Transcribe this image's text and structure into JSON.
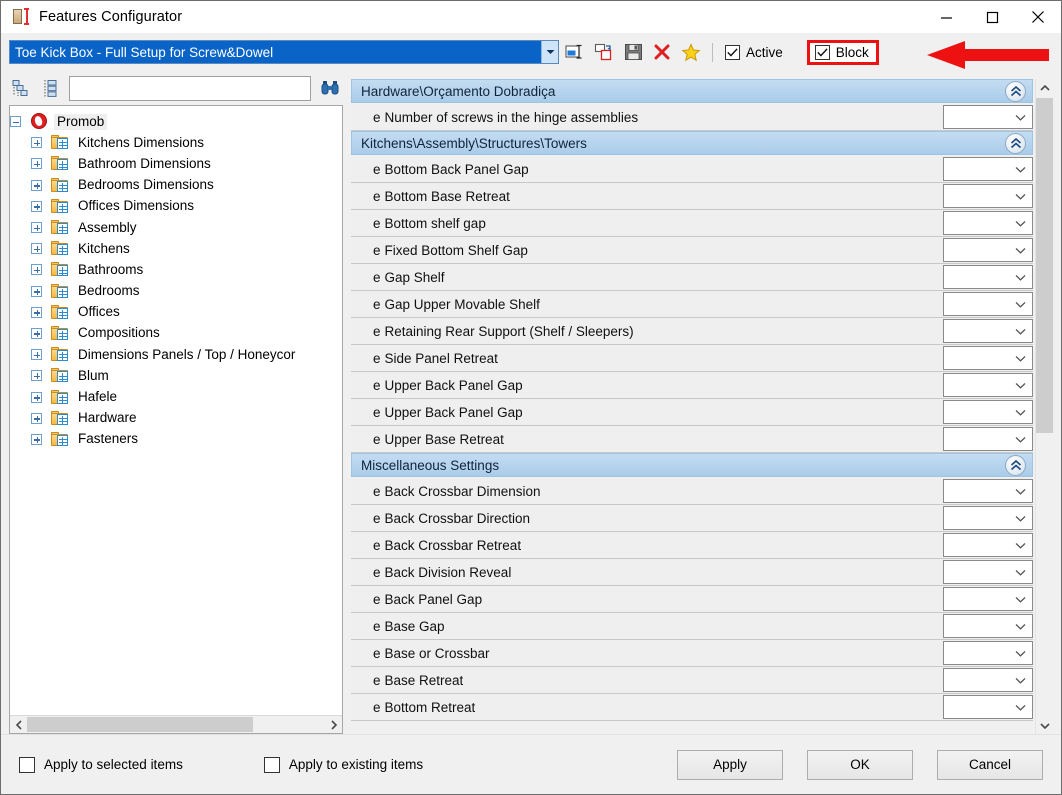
{
  "window": {
    "title": "Features Configurator",
    "app_icon": "cabinet-dimension-icon",
    "controls": {
      "minimize": "minimize-icon",
      "maximize": "maximize-icon",
      "close": "close-icon"
    }
  },
  "toolbar": {
    "preset": {
      "value": "Toe Kick Box - Full Setup for Screw&Dowel",
      "dropdown_icon": "chevron-down-icon"
    },
    "buttons": [
      {
        "name": "rename-preset-button",
        "icon": "rename-icon"
      },
      {
        "name": "duplicate-preset-button",
        "icon": "copy-icon"
      },
      {
        "name": "save-preset-button",
        "icon": "save-disk-icon"
      },
      {
        "name": "delete-preset-button",
        "icon": "delete-x-icon"
      },
      {
        "name": "favorite-preset-button",
        "icon": "star-icon"
      }
    ],
    "active_checkbox": {
      "label": "Active",
      "checked": true
    },
    "block_checkbox": {
      "label": "Block",
      "checked": true
    },
    "annotation": {
      "highlight_color": "#ee1111",
      "arrow": "left-arrow-annotation"
    }
  },
  "tree_panel": {
    "collapse_all_icon": "collapse-tree-icon",
    "expand_all_icon": "expand-tree-icon",
    "search": {
      "value": "",
      "placeholder": ""
    },
    "find_icon": "binoculars-find-icon",
    "root": {
      "label": "Promob",
      "expanded": true,
      "selected": true
    },
    "items": [
      {
        "label": "Kitchens Dimensions"
      },
      {
        "label": "Bathroom Dimensions"
      },
      {
        "label": "Bedrooms Dimensions"
      },
      {
        "label": "Offices Dimensions"
      },
      {
        "label": "Assembly"
      },
      {
        "label": "Kitchens"
      },
      {
        "label": "Bathrooms"
      },
      {
        "label": "Bedrooms"
      },
      {
        "label": "Offices"
      },
      {
        "label": "Compositions"
      },
      {
        "label": "Dimensions Panels / Top / Honeycor"
      },
      {
        "label": "Blum"
      },
      {
        "label": "Hafele"
      },
      {
        "label": "Hardware"
      },
      {
        "label": "Fasteners"
      }
    ],
    "hscroll": {
      "left_icon": "chevron-left-icon",
      "right_icon": "chevron-right-icon"
    }
  },
  "properties": {
    "sections": [
      {
        "title": "Hardware\\Orçamento Dobradiça",
        "collapse_icon": "double-chevron-up-icon",
        "rows": [
          {
            "prefix": "e",
            "label": "Number of screws in the hinge assemblies",
            "value": ""
          }
        ]
      },
      {
        "title": "Kitchens\\Assembly\\Structures\\Towers",
        "collapse_icon": "double-chevron-up-icon",
        "rows": [
          {
            "prefix": "e",
            "label": "Bottom Back Panel Gap",
            "value": ""
          },
          {
            "prefix": "e",
            "label": "Bottom Base Retreat",
            "value": ""
          },
          {
            "prefix": "e",
            "label": "Bottom shelf gap",
            "value": ""
          },
          {
            "prefix": "e",
            "label": "Fixed Bottom Shelf Gap",
            "value": ""
          },
          {
            "prefix": "e",
            "label": "Gap Shelf",
            "value": ""
          },
          {
            "prefix": "e",
            "label": "Gap Upper Movable Shelf",
            "value": ""
          },
          {
            "prefix": "e",
            "label": "Retaining Rear Support (Shelf / Sleepers)",
            "value": ""
          },
          {
            "prefix": "e",
            "label": "Side Panel Retreat",
            "value": ""
          },
          {
            "prefix": "e",
            "label": "Upper Back Panel Gap",
            "value": ""
          },
          {
            "prefix": "e",
            "label": "Upper Back Panel Gap",
            "value": ""
          },
          {
            "prefix": "e",
            "label": "Upper Base Retreat",
            "value": ""
          }
        ]
      },
      {
        "title": "Miscellaneous Settings",
        "collapse_icon": "double-chevron-up-icon",
        "rows": [
          {
            "prefix": "e",
            "label": "Back Crossbar Dimension",
            "value": ""
          },
          {
            "prefix": "e",
            "label": "Back Crossbar Direction",
            "value": ""
          },
          {
            "prefix": "e",
            "label": "Back Crossbar Retreat",
            "value": ""
          },
          {
            "prefix": "e",
            "label": "Back Division Reveal",
            "value": ""
          },
          {
            "prefix": "e",
            "label": "Back Panel Gap",
            "value": ""
          },
          {
            "prefix": "e",
            "label": "Base Gap",
            "value": ""
          },
          {
            "prefix": "e",
            "label": "Base or Crossbar",
            "value": ""
          },
          {
            "prefix": "e",
            "label": "Base Retreat",
            "value": ""
          },
          {
            "prefix": "e",
            "label": "Bottom Retreat",
            "value": ""
          }
        ]
      }
    ],
    "vscroll": {
      "up_icon": "chevron-up-icon",
      "down_icon": "chevron-down-icon"
    }
  },
  "footer": {
    "apply_selected_checkbox": {
      "label": "Apply to selected items",
      "checked": false
    },
    "apply_existing_checkbox": {
      "label": "Apply to existing items",
      "checked": false
    },
    "buttons": [
      {
        "name": "apply-button",
        "label": "Apply"
      },
      {
        "name": "ok-button",
        "label": "OK"
      },
      {
        "name": "cancel-button",
        "label": "Cancel"
      }
    ]
  },
  "colors": {
    "selection_blue": "#0a64c8",
    "section_header": "#aacce9",
    "annotation_red": "#ee1111"
  }
}
